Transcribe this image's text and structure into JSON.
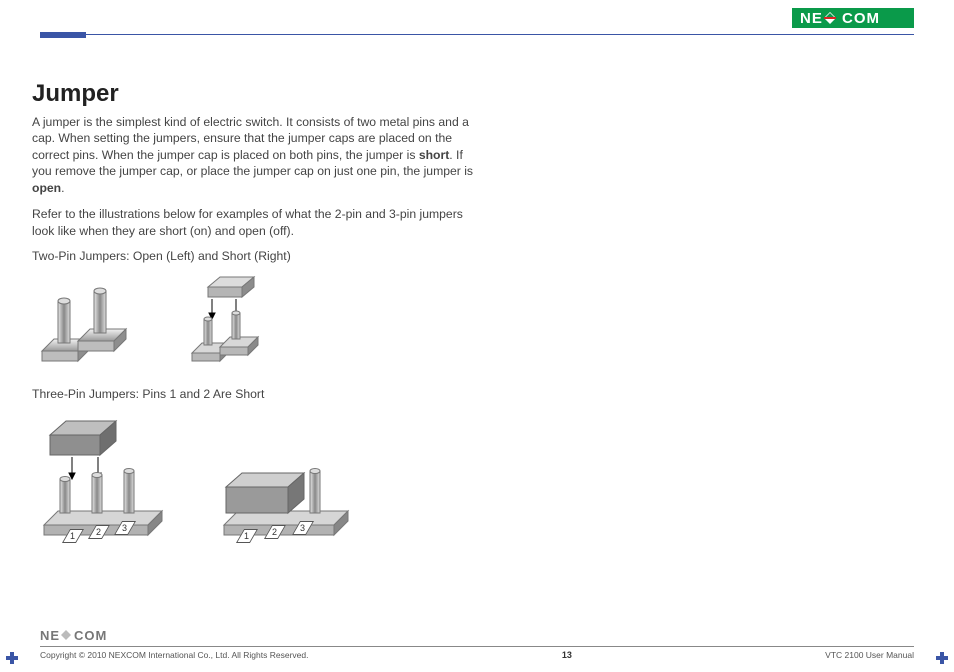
{
  "brand": "NEXCOM",
  "header_rule_color": "#3a55a6",
  "title": "Jumper",
  "para1_a": "A jumper is the simplest kind of electric switch. It consists of two metal pins and a cap. When setting the jumpers, ensure that the jumper caps are placed on the correct pins. When the jumper cap is placed on both pins, the jumper is ",
  "para1_b": "short",
  "para1_c": ". If you remove the jumper cap, or place the jumper cap on just one pin, the jumper is ",
  "para1_d": "open",
  "para1_e": ".",
  "para2": "Refer to the illustrations below for examples of what the 2-pin and 3-pin jumpers look like when they are short (on) and open (off).",
  "cap1": "Two-Pin Jumpers: Open (Left) and Short (Right)",
  "cap2": "Three-Pin Jumpers: Pins 1 and 2 Are Short",
  "pin_labels": {
    "p1": "1",
    "p2": "2",
    "p3": "3"
  },
  "footer_copyright": "Copyright © 2010 NEXCOM International Co., Ltd. All Rights Reserved.",
  "footer_page": "13",
  "footer_doc": "VTC 2100 User Manual"
}
